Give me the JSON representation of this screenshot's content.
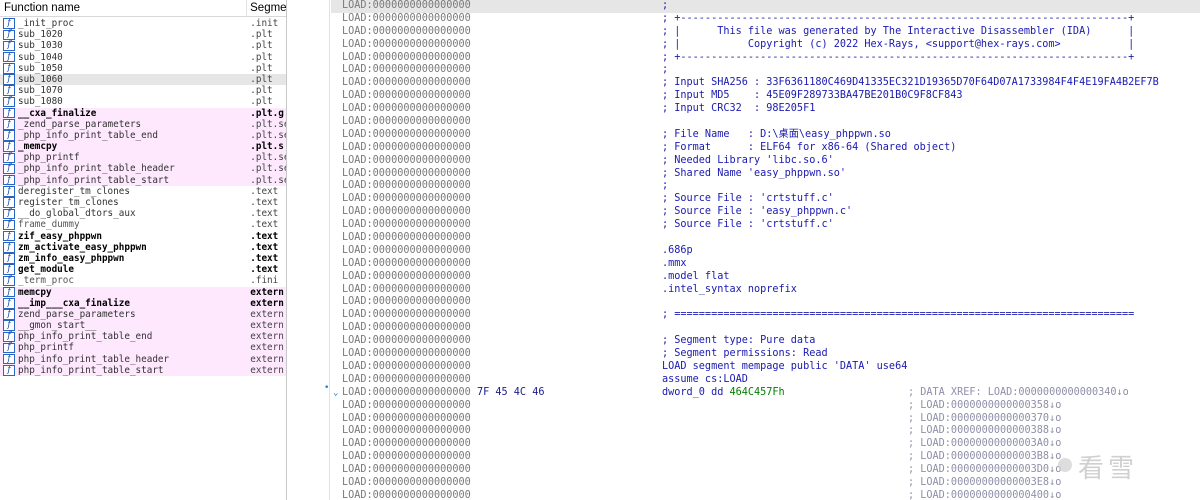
{
  "function_pane": {
    "header_name": "Function name",
    "header_segment": "Segme",
    "icon_glyph": "f",
    "rows": [
      {
        "name": "_init_proc",
        "seg": ".init",
        "style": "normal"
      },
      {
        "name": "sub_1020",
        "seg": ".plt",
        "style": "normal"
      },
      {
        "name": "sub_1030",
        "seg": ".plt",
        "style": "normal"
      },
      {
        "name": "sub_1040",
        "seg": ".plt",
        "style": "normal"
      },
      {
        "name": "sub_1050",
        "seg": ".plt",
        "style": "normal"
      },
      {
        "name": "sub_1060",
        "seg": ".plt",
        "style": "selected"
      },
      {
        "name": "sub_1070",
        "seg": ".plt",
        "style": "normal"
      },
      {
        "name": "sub_1080",
        "seg": ".plt",
        "style": "normal"
      },
      {
        "name": "__cxa_finalize",
        "seg": ".plt.g",
        "style": "pink-bold"
      },
      {
        "name": "_zend_parse_parameters",
        "seg": ".plt.se",
        "style": "pink"
      },
      {
        "name": "_php_info_print_table_end",
        "seg": ".plt.se",
        "style": "pink"
      },
      {
        "name": "_memcpy",
        "seg": ".plt.s",
        "style": "pink-bold"
      },
      {
        "name": "_php_printf",
        "seg": ".plt.se",
        "style": "pink"
      },
      {
        "name": "_php_info_print_table_header",
        "seg": ".plt.se",
        "style": "pink"
      },
      {
        "name": "_php_info_print_table_start",
        "seg": ".plt.se",
        "style": "pink"
      },
      {
        "name": "deregister_tm_clones",
        "seg": ".text",
        "style": "normal"
      },
      {
        "name": "register_tm_clones",
        "seg": ".text",
        "style": "normal"
      },
      {
        "name": "__do_global_dtors_aux",
        "seg": ".text",
        "style": "normal"
      },
      {
        "name": "frame_dummy",
        "seg": ".text",
        "style": "dim"
      },
      {
        "name": "zif_easy_phppwn",
        "seg": ".text",
        "style": "bold"
      },
      {
        "name": "zm_activate_easy_phppwn",
        "seg": ".text",
        "style": "bold"
      },
      {
        "name": "zm_info_easy_phppwn",
        "seg": ".text",
        "style": "bold"
      },
      {
        "name": "get_module",
        "seg": ".text",
        "style": "bold"
      },
      {
        "name": "_term_proc",
        "seg": ".fini",
        "style": "dim"
      },
      {
        "name": "memcpy",
        "seg": "extern",
        "style": "pink-bold"
      },
      {
        "name": "__imp___cxa_finalize",
        "seg": "extern",
        "style": "pink-bold"
      },
      {
        "name": "zend_parse_parameters",
        "seg": "extern",
        "style": "pink"
      },
      {
        "name": "__gmon_start__",
        "seg": "extern",
        "style": "pink"
      },
      {
        "name": "php_info_print_table_end",
        "seg": "extern",
        "style": "pink"
      },
      {
        "name": "php_printf",
        "seg": "extern",
        "style": "pink"
      },
      {
        "name": "php_info_print_table_header",
        "seg": "extern",
        "style": "pink"
      },
      {
        "name": "php_info_print_table_start",
        "seg": "extern",
        "style": "pink"
      }
    ]
  },
  "disassembly": {
    "lines": [
      {
        "addr": "LOAD:0000000000000000",
        "bytes": "",
        "code": ";",
        "xref": ""
      },
      {
        "addr": "LOAD:0000000000000000",
        "bytes": "",
        "code": "; +-------------------------------------------------------------------------+",
        "xref": ""
      },
      {
        "addr": "LOAD:0000000000000000",
        "bytes": "",
        "code": "; |      This file was generated by The Interactive Disassembler (IDA)      |",
        "xref": ""
      },
      {
        "addr": "LOAD:0000000000000000",
        "bytes": "",
        "code": "; |           Copyright (c) 2022 Hex-Rays, <support@hex-rays.com>           |",
        "xref": ""
      },
      {
        "addr": "LOAD:0000000000000000",
        "bytes": "",
        "code": "; +-------------------------------------------------------------------------+",
        "xref": ""
      },
      {
        "addr": "LOAD:0000000000000000",
        "bytes": "",
        "code": ";",
        "xref": ""
      },
      {
        "addr": "LOAD:0000000000000000",
        "bytes": "",
        "code": "; Input SHA256 : 33F6361180C469D41335EC321D19365D70F64D07A1733984F4F4E19FA4B2EF7B",
        "xref": ""
      },
      {
        "addr": "LOAD:0000000000000000",
        "bytes": "",
        "code": "; Input MD5    : 45E09F289733BA47BE201B0C9F8CF843",
        "xref": ""
      },
      {
        "addr": "LOAD:0000000000000000",
        "bytes": "",
        "code": "; Input CRC32  : 98E205F1",
        "xref": ""
      },
      {
        "addr": "LOAD:0000000000000000",
        "bytes": "",
        "code": "",
        "xref": ""
      },
      {
        "addr": "LOAD:0000000000000000",
        "bytes": "",
        "code": "; File Name   : D:\\桌面\\easy_phppwn.so",
        "xref": ""
      },
      {
        "addr": "LOAD:0000000000000000",
        "bytes": "",
        "code": "; Format      : ELF64 for x86-64 (Shared object)",
        "xref": ""
      },
      {
        "addr": "LOAD:0000000000000000",
        "bytes": "",
        "code": "; Needed Library 'libc.so.6'",
        "xref": ""
      },
      {
        "addr": "LOAD:0000000000000000",
        "bytes": "",
        "code": "; Shared Name 'easy_phppwn.so'",
        "xref": ""
      },
      {
        "addr": "LOAD:0000000000000000",
        "bytes": "",
        "code": ";",
        "xref": ""
      },
      {
        "addr": "LOAD:0000000000000000",
        "bytes": "",
        "code": "; Source File : 'crtstuff.c'",
        "xref": ""
      },
      {
        "addr": "LOAD:0000000000000000",
        "bytes": "",
        "code": "; Source File : 'easy_phppwn.c'",
        "xref": ""
      },
      {
        "addr": "LOAD:0000000000000000",
        "bytes": "",
        "code": "; Source File : 'crtstuff.c'",
        "xref": ""
      },
      {
        "addr": "LOAD:0000000000000000",
        "bytes": "",
        "code": "",
        "xref": ""
      },
      {
        "addr": "LOAD:0000000000000000",
        "bytes": "",
        "code": ".686p",
        "xref": ""
      },
      {
        "addr": "LOAD:0000000000000000",
        "bytes": "",
        "code": ".mmx",
        "xref": ""
      },
      {
        "addr": "LOAD:0000000000000000",
        "bytes": "",
        "code": ".model flat",
        "xref": ""
      },
      {
        "addr": "LOAD:0000000000000000",
        "bytes": "",
        "code": ".intel_syntax noprefix",
        "xref": ""
      },
      {
        "addr": "LOAD:0000000000000000",
        "bytes": "",
        "code": "",
        "xref": ""
      },
      {
        "addr": "LOAD:0000000000000000",
        "bytes": "",
        "code": "; ===========================================================================",
        "xref": ""
      },
      {
        "addr": "LOAD:0000000000000000",
        "bytes": "",
        "code": "",
        "xref": ""
      },
      {
        "addr": "LOAD:0000000000000000",
        "bytes": "",
        "code": "; Segment type: Pure data",
        "xref": ""
      },
      {
        "addr": "LOAD:0000000000000000",
        "bytes": "",
        "code": "; Segment permissions: Read",
        "xref": ""
      },
      {
        "addr": "LOAD:0000000000000000",
        "bytes": "",
        "code": "LOAD segment mempage public 'DATA' use64",
        "xref": ""
      },
      {
        "addr": "LOAD:0000000000000000",
        "bytes": "",
        "code": "assume cs:LOAD",
        "xref": ""
      },
      {
        "addr": "LOAD:0000000000000000",
        "bytes": "7F 45 4C 46",
        "code_pre": "dword_0 dd ",
        "code_num": "464C457Fh",
        "xref": "; DATA XREF: LOAD:0000000000000340↓o",
        "chevron": "⌄"
      },
      {
        "addr": "LOAD:0000000000000000",
        "bytes": "",
        "code": "",
        "xref": "; LOAD:0000000000000358↓o"
      },
      {
        "addr": "LOAD:0000000000000000",
        "bytes": "",
        "code": "",
        "xref": "; LOAD:0000000000000370↓o"
      },
      {
        "addr": "LOAD:0000000000000000",
        "bytes": "",
        "code": "",
        "xref": "; LOAD:0000000000000388↓o"
      },
      {
        "addr": "LOAD:0000000000000000",
        "bytes": "",
        "code": "",
        "xref": "; LOAD:00000000000003A0↓o"
      },
      {
        "addr": "LOAD:0000000000000000",
        "bytes": "",
        "code": "",
        "xref": "; LOAD:00000000000003B8↓o"
      },
      {
        "addr": "LOAD:0000000000000000",
        "bytes": "",
        "code": "",
        "xref": "; LOAD:00000000000003D0↓o"
      },
      {
        "addr": "LOAD:0000000000000000",
        "bytes": "",
        "code": "",
        "xref": "; LOAD:00000000000003E8↓o"
      },
      {
        "addr": "LOAD:0000000000000000",
        "bytes": "",
        "code": "",
        "xref": "; LOAD:0000000000000400↓o"
      }
    ]
  },
  "gutter": {
    "arrow_glyph": "•"
  },
  "watermark": {
    "text": "看雪"
  },
  "colors": {
    "extern_plt_bg": "#fde8fd",
    "selected_bg": "#e6e6e6",
    "code_blue": "#1a1ab0",
    "number_green": "#008000",
    "xref_gray": "#8f8fa8"
  }
}
